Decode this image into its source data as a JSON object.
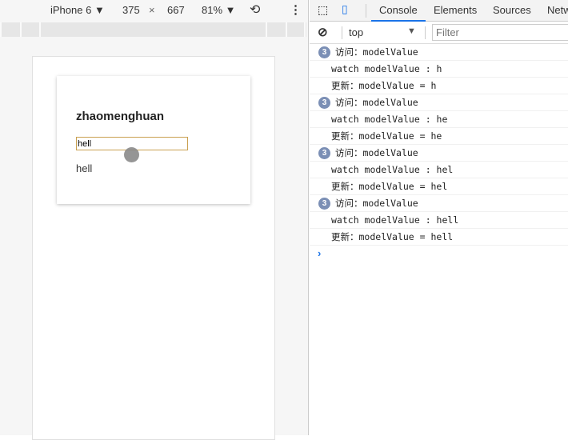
{
  "device_toolbar": {
    "device": "iPhone 6",
    "width": "375",
    "times": "×",
    "height": "667",
    "zoom": "81%"
  },
  "page": {
    "title": "zhaomenghuan",
    "input_value": "hell",
    "output": "hell"
  },
  "devtools": {
    "tabs": [
      "Console",
      "Elements",
      "Sources",
      "Netw"
    ],
    "context": "top",
    "filter_placeholder": "Filter"
  },
  "console": [
    {
      "count": "3",
      "text": "访问：modelValue"
    },
    {
      "text": "watch modelValue : h"
    },
    {
      "text": "更新：modelValue = h"
    },
    {
      "count": "3",
      "text": "访问：modelValue"
    },
    {
      "text": "watch modelValue : he"
    },
    {
      "text": "更新：modelValue = he"
    },
    {
      "count": "3",
      "text": "访问：modelValue"
    },
    {
      "text": "watch modelValue : hel"
    },
    {
      "text": "更新：modelValue = hel"
    },
    {
      "count": "3",
      "text": "访问：modelValue"
    },
    {
      "text": "watch modelValue : hell"
    },
    {
      "text": "更新：modelValue = hell"
    }
  ],
  "prompt": "›"
}
